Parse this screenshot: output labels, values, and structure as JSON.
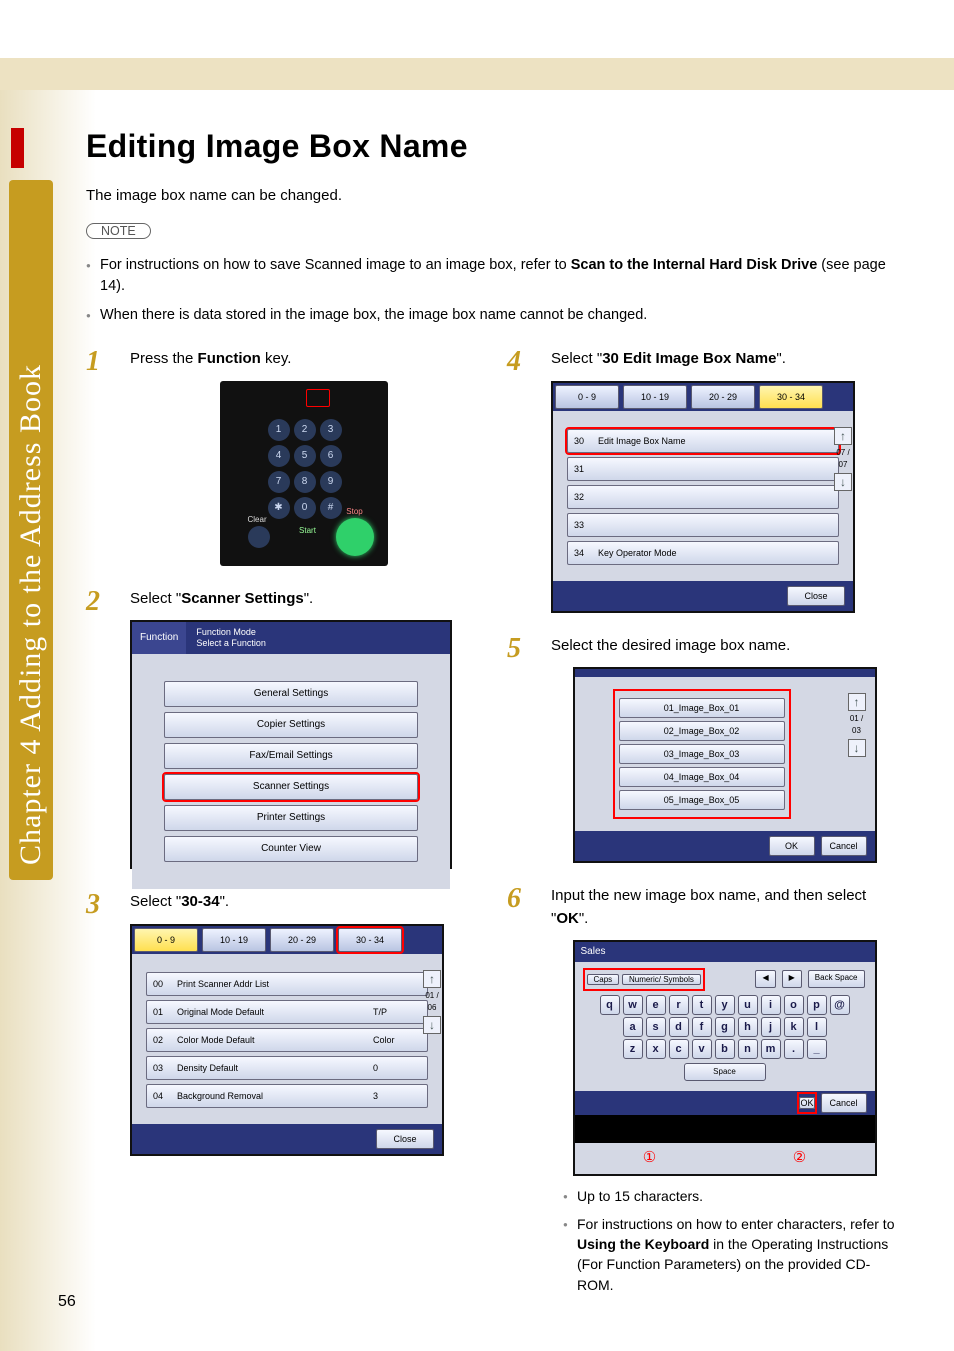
{
  "chapter": "Chapter 4   Adding to the Address Book",
  "title": "Editing Image Box Name",
  "intro": "The image box name can be changed.",
  "note_label": "NOTE",
  "notes": [
    {
      "pre": "For instructions on how to save Scanned image to an image box, refer to ",
      "b": "Scan to the Internal Hard Disk Drive",
      "post": " (see page 14)."
    },
    {
      "text": "When there is data stored in the image box, the image box name cannot be changed."
    }
  ],
  "left": [
    {
      "num": "1",
      "pre": "Press the ",
      "b": "Function",
      "post": " key."
    },
    {
      "num": "2",
      "pre": "Select \"",
      "b": "Scanner Settings",
      "post": "\"."
    },
    {
      "num": "3",
      "pre": "Select \"",
      "b": "30-34",
      "post": "\"."
    }
  ],
  "right": [
    {
      "num": "4",
      "pre": "Select \"",
      "b": "30 Edit Image Box Name",
      "post": "\"."
    },
    {
      "num": "5",
      "text": "Select the desired image box name."
    },
    {
      "num": "6",
      "pre": "Input the new image box name, and then select \"",
      "b": "OK",
      "post": "\".",
      "sub": [
        "Up to 15 characters."
      ],
      "sub1_pre": "For instructions on how to enter characters, refer to ",
      "sub1_b": "Using the Keyboard",
      "sub1_post": " in the Operating Instructions (For Function Parameters) on the provided CD-ROM."
    }
  ],
  "screens": {
    "s2": {
      "header": "Function",
      "sub1": "Function Mode",
      "sub2": "Select a Function",
      "items": [
        "General Settings",
        "Copier Settings",
        "Fax/Email Settings",
        "Scanner Settings",
        "Printer Settings",
        "Counter View"
      ]
    },
    "s3": {
      "tabs": [
        "0 - 9",
        "10 - 19",
        "20 - 29",
        "30 - 34"
      ],
      "rows": [
        {
          "n": "00",
          "l": "Print Scanner Addr List",
          "v": ""
        },
        {
          "n": "01",
          "l": "Original Mode Default",
          "v": "T/P"
        },
        {
          "n": "02",
          "l": "Color Mode Default",
          "v": "Color"
        },
        {
          "n": "03",
          "l": "Density Default",
          "v": "0"
        },
        {
          "n": "04",
          "l": "Background Removal",
          "v": "3"
        }
      ],
      "page": "01\n/\n06",
      "close": "Close"
    },
    "s4": {
      "tabs": [
        "0 - 9",
        "10 - 19",
        "20 - 29",
        "30 - 34"
      ],
      "rows": [
        {
          "n": "30",
          "l": "Edit Image Box Name"
        },
        {
          "n": "31",
          "l": ""
        },
        {
          "n": "32",
          "l": ""
        },
        {
          "n": "33",
          "l": ""
        },
        {
          "n": "34",
          "l": "Key Operator Mode"
        }
      ],
      "page": "07\n/\n07",
      "close": "Close"
    },
    "s5": {
      "items": [
        "01_Image_Box_01",
        "02_Image_Box_02",
        "03_Image_Box_03",
        "04_Image_Box_04",
        "05_Image_Box_05"
      ],
      "page": "01\n/\n03",
      "ok": "OK",
      "cancel": "Cancel"
    },
    "s6": {
      "value": "Sales",
      "caps": "Caps",
      "numsym": "Numeric/\nSymbols",
      "backspace": "Back Space",
      "space": "Space",
      "ok": "OK",
      "cancel": "Cancel",
      "m1": "①",
      "m2": "②"
    }
  },
  "page_number": "56"
}
